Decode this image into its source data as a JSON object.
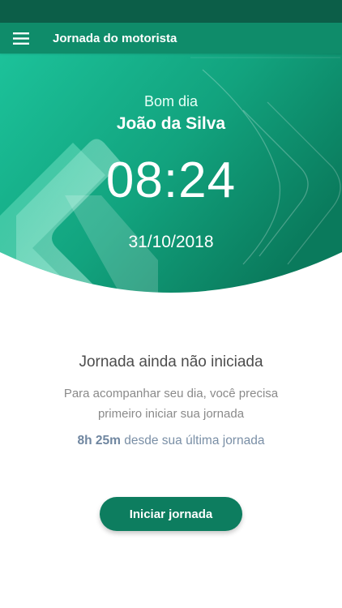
{
  "app_bar": {
    "title": "Jornada do motorista",
    "menu_icon": "hamburger-menu-icon"
  },
  "hero": {
    "greeting": "Bom dia",
    "user_name": "João da Silva",
    "time": "08:24",
    "date": "31/10/2018"
  },
  "journey": {
    "title": "Jornada ainda não iniciada",
    "description": "Para acompanhar seu dia, você precisa primeiro iniciar sua jornada",
    "elapsed_value": "8h 25m",
    "elapsed_suffix": " desde sua última jornada"
  },
  "actions": {
    "start_label": "Iniciar jornada"
  },
  "colors": {
    "status_bar": "#0c5e48",
    "app_bar": "#0f8c6a",
    "hero_gradient_start": "#1cc29a",
    "hero_gradient_end": "#0a7a5c",
    "button": "#0d7d5f",
    "accent_text": "#6f86a0"
  }
}
